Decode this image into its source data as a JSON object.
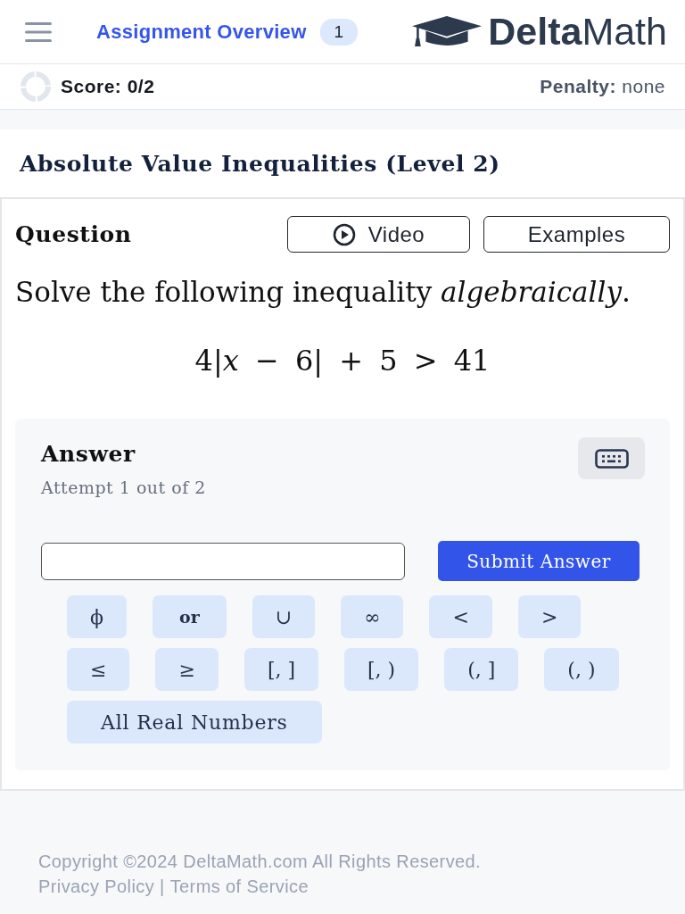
{
  "header": {
    "nav_link": "Assignment Overview",
    "badge": "1",
    "logo": "**Delta**Math"
  },
  "score_bar": {
    "score": "Score: 0/2",
    "penalty": "**Penalty:** none"
  },
  "title": "Absolute Value Inequalities (Level 2)",
  "question": {
    "heading": "Question",
    "buttons": [
      {
        "label": "Video",
        "kind": "video"
      },
      {
        "label": "Examples",
        "kind": "plain"
      }
    ],
    "prompt": "Solve the following inequality *algebraically*.",
    "expression": "4|*x* − 6| + 5 > 41"
  },
  "answer": {
    "heading": "Answer",
    "attempt": "Attempt 1 out of 2",
    "submit": "Submit Answer",
    "keypad": [
      [
        {
          "label": "ϕ",
          "kind": "operator"
        },
        {
          "label": "or",
          "kind": "keyword"
        },
        {
          "label": "∪",
          "kind": "operator"
        },
        {
          "label": "∞",
          "kind": "operator"
        },
        {
          "label": "<",
          "kind": "operator"
        },
        {
          "label": ">",
          "kind": "operator"
        }
      ],
      [
        {
          "label": "≤",
          "kind": "operator"
        },
        {
          "label": "≥",
          "kind": "operator"
        },
        {
          "label": "[, ]",
          "kind": "operator"
        },
        {
          "label": "[, )",
          "kind": "operator"
        },
        {
          "label": "(, ]",
          "kind": "operator"
        },
        {
          "label": "(, )",
          "kind": "operator"
        }
      ],
      [
        {
          "label": "All Real Numbers",
          "kind": "option"
        }
      ]
    ]
  },
  "footer": {
    "copyright": "Copyright ©2024 DeltaMath.com All Rights Reserved.",
    "links": [
      "Privacy Policy",
      "Terms of Service"
    ],
    "separator": "|"
  }
}
